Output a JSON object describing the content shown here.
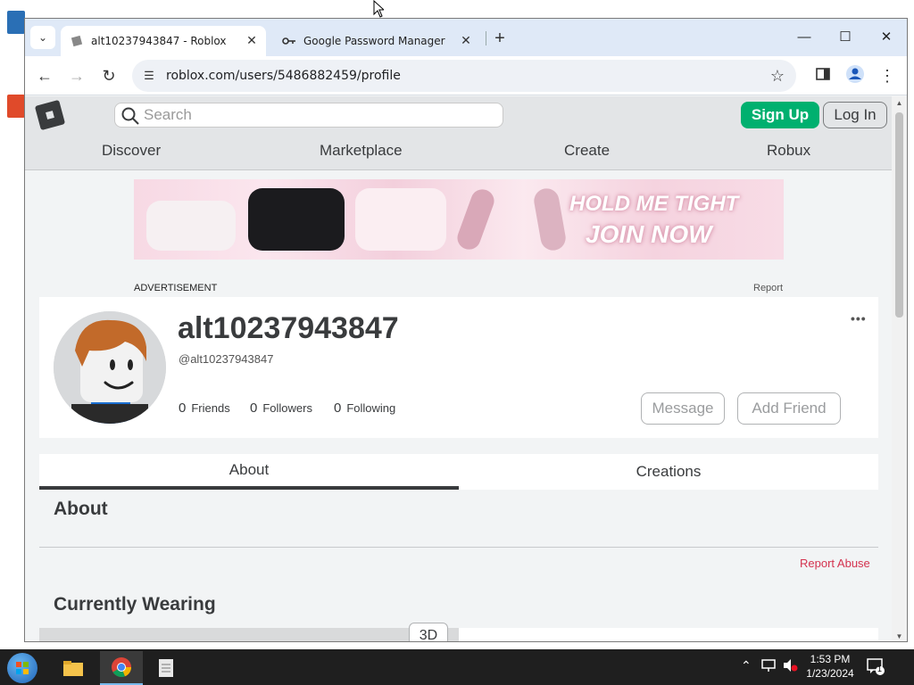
{
  "browser": {
    "tabs": [
      {
        "title": "alt10237943847 - Roblox",
        "active": true
      },
      {
        "title": "Google Password Manager",
        "active": false
      }
    ],
    "url": "roblox.com/users/5486882459/profile"
  },
  "roblox": {
    "search_placeholder": "Search",
    "signup_label": "Sign Up",
    "login_label": "Log In",
    "nav": [
      "Discover",
      "Marketplace",
      "Create",
      "Robux"
    ],
    "ad": {
      "label": "ADVERTISEMENT",
      "report_label": "Report",
      "text_line1": "HOLD ME TIGHT",
      "text_line2": "JOIN NOW"
    },
    "profile": {
      "display_name": "alt10237943847",
      "handle": "@alt10237943847",
      "friends_count": "0",
      "friends_label": "Friends",
      "followers_count": "0",
      "followers_label": "Followers",
      "following_count": "0",
      "following_label": "Following",
      "more_label": "•••",
      "message_label": "Message",
      "add_friend_label": "Add Friend"
    },
    "tabs": [
      "About",
      "Creations"
    ],
    "about_title": "About",
    "report_abuse_label": "Report Abuse",
    "currently_wearing_title": "Currently Wearing",
    "three_d_label": "3D"
  },
  "taskbar": {
    "time": "1:53 PM",
    "date": "1/23/2024",
    "notification_count": "1"
  },
  "colors": {
    "signup_green": "#00b06f",
    "report_red": "#d4334f",
    "tabstrip_blue": "#dfe9f7",
    "text_dark": "#393b3d"
  }
}
